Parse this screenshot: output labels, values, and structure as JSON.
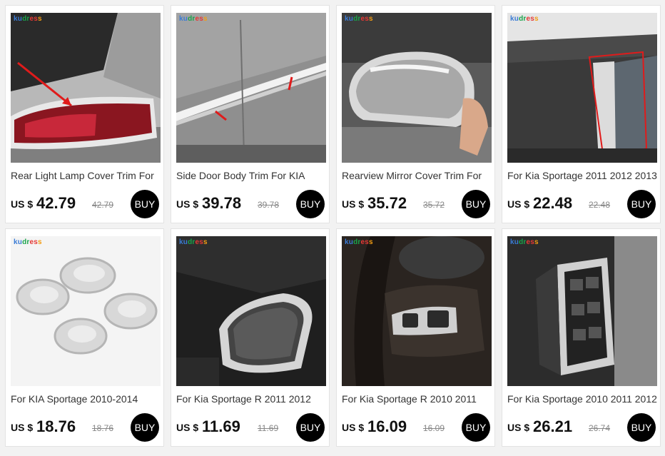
{
  "brand_parts": [
    "ku",
    "dr",
    "es",
    "s"
  ],
  "products": [
    {
      "title": "Rear Light Lamp Cover Trim For",
      "currency": "US $",
      "price": "42.79",
      "old_price": "42.79",
      "buy_label": "BUY",
      "image_icon": "tail-light-photo"
    },
    {
      "title": "Side Door Body Trim For KIA",
      "currency": "US $",
      "price": "39.78",
      "old_price": "39.78",
      "buy_label": "BUY",
      "image_icon": "door-trim-photo"
    },
    {
      "title": "Rearview Mirror Cover Trim For",
      "currency": "US $",
      "price": "35.72",
      "old_price": "35.72",
      "buy_label": "BUY",
      "image_icon": "mirror-cover-photo"
    },
    {
      "title": "For Kia Sportage 2011 2012 2013",
      "currency": "US $",
      "price": "22.48",
      "old_price": "22.48",
      "buy_label": "BUY",
      "image_icon": "window-pillar-photo"
    },
    {
      "title": "For KIA Sportage 2010-2014",
      "currency": "US $",
      "price": "18.76",
      "old_price": "18.76",
      "buy_label": "BUY",
      "image_icon": "door-bowl-covers-photo"
    },
    {
      "title": "For Kia Sportage R 2011 2012",
      "currency": "US $",
      "price": "11.69",
      "old_price": "11.69",
      "buy_label": "BUY",
      "image_icon": "speaker-trim-photo"
    },
    {
      "title": "For Kia Sportage R 2010 2011",
      "currency": "US $",
      "price": "16.09",
      "old_price": "16.09",
      "buy_label": "BUY",
      "image_icon": "steering-wheel-trim-photo"
    },
    {
      "title": "For Kia Sportage 2010 2011 2012",
      "currency": "US $",
      "price": "26.21",
      "old_price": "26.74",
      "buy_label": "BUY",
      "image_icon": "window-switch-trim-photo"
    }
  ]
}
